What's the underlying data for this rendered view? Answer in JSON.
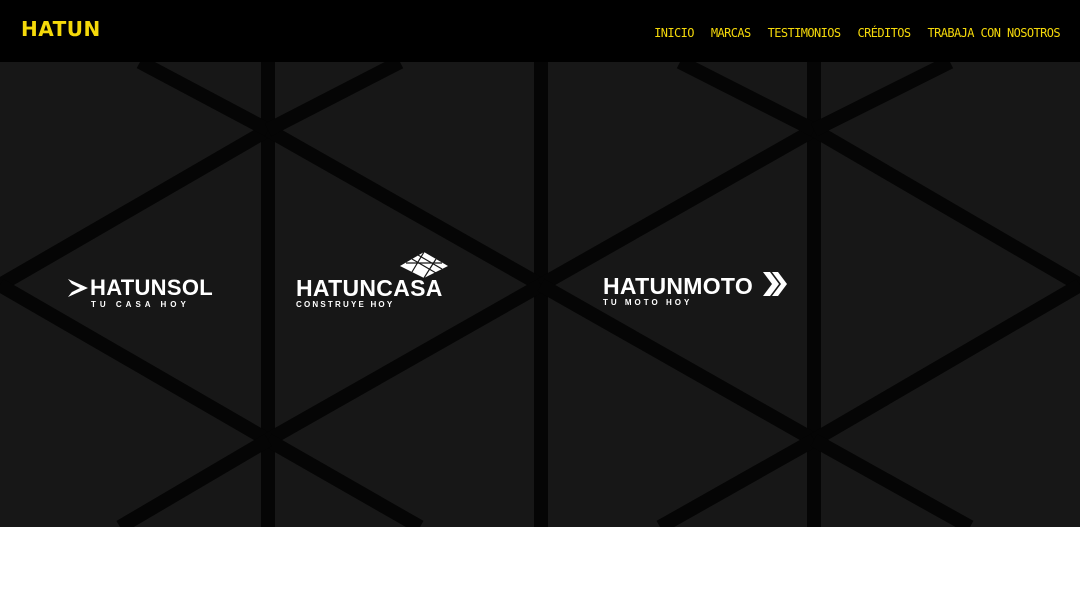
{
  "header": {
    "logo": "HATUN",
    "nav": [
      {
        "label": "INICIO"
      },
      {
        "label": "MARCAS"
      },
      {
        "label": "TESTIMONIOS"
      },
      {
        "label": "CRÉDITOS"
      },
      {
        "label": "TRABAJA CON NOSOTROS"
      }
    ]
  },
  "brands": [
    {
      "name": "HATUNSOL",
      "tagline": "TU CASA HOY",
      "icon": "sun-arrow-icon"
    },
    {
      "name": "HATUNCASA",
      "tagline": "CONSTRUYE HOY",
      "icon": "house-grid-icon"
    },
    {
      "name": "HATUNMOTO",
      "tagline": "TU MOTO HOY",
      "icon": "chevrons-icon"
    }
  ],
  "colors": {
    "accent": "#f5d90a",
    "header_bg": "#000000",
    "hero_bg": "#171717",
    "lines": "#050505",
    "logo_text": "#ffffff"
  }
}
